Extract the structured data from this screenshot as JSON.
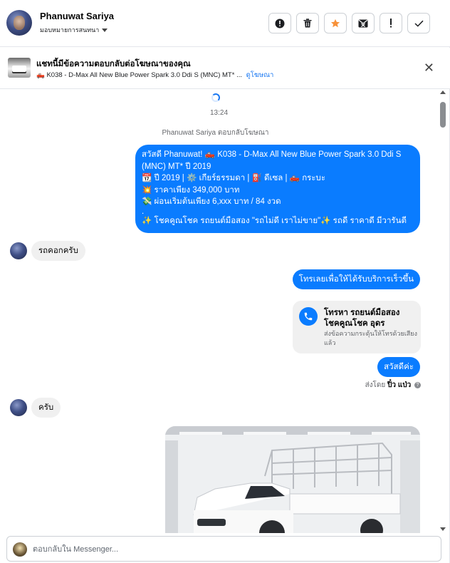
{
  "header": {
    "user_name": "Phanuwat Sariya",
    "assign_label": "มอบหมายการสนทนา",
    "actions": [
      "mark-spam",
      "delete",
      "star",
      "mark-unread",
      "flag",
      "done"
    ]
  },
  "banner": {
    "title": "แชทนี้มีข้อความตอบกลับต่อโฆษณาของคุณ",
    "subtitle": "🛻 K038 - D-Max All New Blue Power Spark 3.0 Ddi S (MNC) MT* ...",
    "link": "ดูโฆษณา"
  },
  "thread": {
    "time": "13:24",
    "reply_note": "Phanuwat Sariya ตอบกลับโฆษณา",
    "ad_message_lines": [
      "สวัสดี Phanuwat! 🛻 K038 - D-Max All New Blue Power Spark 3.0 Ddi S (MNC) MT* ปี 2019",
      "📆 ปี 2019 | ⚙️ เกียร์ธรรมดา | ⛽ ดีเซล | 🛻 กระบะ",
      "💥 ราคาเพียง 349,000 บาท",
      "💸 ผ่อนเริ่มต้นเพียง 6,xxx บาท / 84 งวด",
      ".",
      "✨ โชคคูณโชค รถยนต์มือสอง \"รถไม่ดี เราไม่ขาย\"✨ รถดี ราคาดี มีวารันตี"
    ],
    "incoming_1": "รถคอกครับ",
    "outgoing_call_prompt": "โทรเลยเพื่อให้ได้รับบริการเร็วขึ้น",
    "call_card": {
      "title": "โทรหา รถยนต์มือสอง โชคคูณโชค อุดร",
      "subtitle": "ส่งข้อความกระตุ้นให้โทรด้วยเสียงแล้ว"
    },
    "outgoing_greeting": "สวัสดีค่ะ",
    "sent_by_prefix": "ส่งโดย",
    "sent_by_name": "ปิ๋ว แป่ว",
    "incoming_2": "ครับ"
  },
  "composer": {
    "placeholder": "ตอบกลับใน Messenger..."
  },
  "colors": {
    "accent": "#0a7cff",
    "star": "#f7923a"
  }
}
